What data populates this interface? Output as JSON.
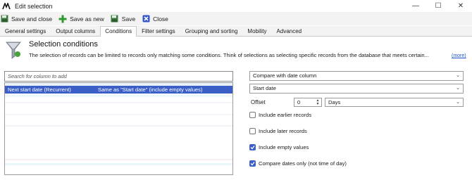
{
  "window": {
    "title": "Edit selection",
    "controls": {
      "minimize": "—",
      "maximize": "☐",
      "close": "✕"
    }
  },
  "toolbar": {
    "save_close": "Save and close",
    "save_new": "Save as new",
    "save": "Save",
    "close": "Close"
  },
  "tabs": [
    {
      "label": "General settings",
      "active": false
    },
    {
      "label": "Output columns",
      "active": false
    },
    {
      "label": "Conditions",
      "active": true
    },
    {
      "label": "Filter settings",
      "active": false
    },
    {
      "label": "Grouping and sorting",
      "active": false
    },
    {
      "label": "Mobility",
      "active": false
    },
    {
      "label": "Advanced",
      "active": false
    }
  ],
  "header": {
    "title": "Selection conditions",
    "description": "The selection of records can be limited to records only matching some conditions. Think of selections as selecting specific records from the database that meets certain...",
    "more": "(more)"
  },
  "search": {
    "placeholder": "Search for column to add",
    "value": ""
  },
  "conditions": {
    "selected_row": {
      "column": "Next start date (Recurrent)",
      "condition": "Same as \"Start date\" (include empty values)"
    }
  },
  "editor": {
    "compare_mode": "Compare with date column",
    "date_column": "Start date",
    "offset_label": "Offset",
    "offset_value": "0",
    "offset_unit": "Days",
    "checkboxes": [
      {
        "label": "Include earlier records",
        "checked": false
      },
      {
        "label": "Include later records",
        "checked": false
      },
      {
        "label": "Include empty values",
        "checked": true
      },
      {
        "label": "Compare dates only (not time of day)",
        "checked": true
      }
    ]
  },
  "colors": {
    "accent": "#3b5fc7",
    "link": "#1a55c8",
    "toolbar_bg": "#f3f3f3"
  },
  "icons": {
    "app": "app-logo-icon",
    "save_close": "disk-icon",
    "save_new": "plus-icon",
    "save": "disk-icon",
    "close": "close-x-icon",
    "section": "funnel-filter-icon"
  }
}
